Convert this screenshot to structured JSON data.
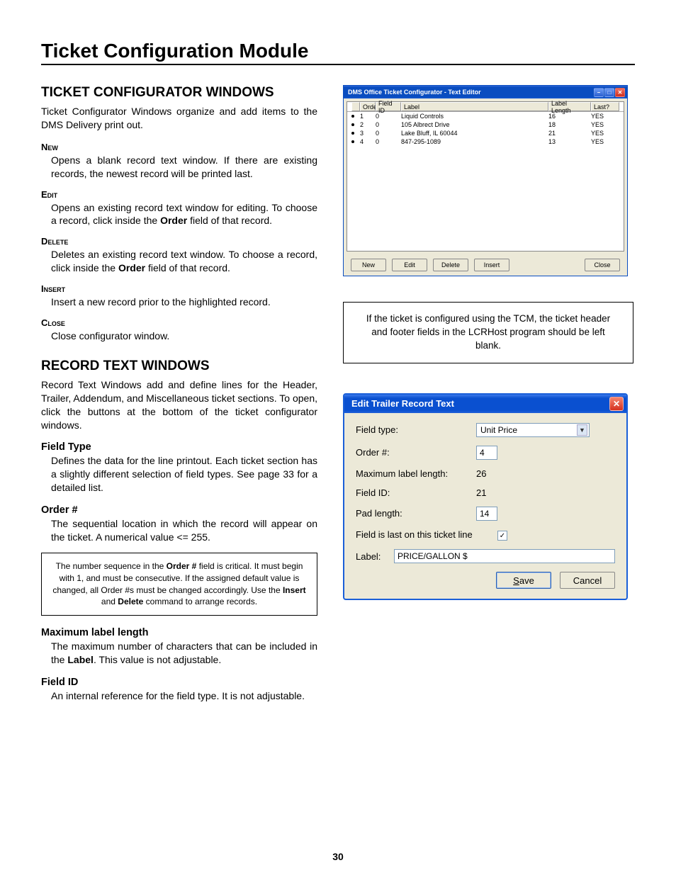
{
  "page": {
    "title": "Ticket Configuration Module",
    "number": "30"
  },
  "section1": {
    "heading": "TICKET CONFIGURATOR WINDOWS",
    "intro": "Ticket Configurator Windows organize and add items to the DMS Delivery print out.",
    "defs": [
      {
        "term": "New",
        "desc_parts": [
          "Opens a blank record text window. If there are existing records, the newest record will be printed last."
        ]
      },
      {
        "term": "Edit",
        "desc_parts": [
          "Opens an existing record text window for editing. To choose a record, click inside the ",
          "Order",
          " field of that record."
        ]
      },
      {
        "term": "Delete",
        "desc_parts": [
          "Deletes an existing record text window. To choose a record, click inside the ",
          "Order",
          " field of that record."
        ]
      },
      {
        "term": "Insert",
        "desc_parts": [
          "Insert a new record prior to the highlighted record."
        ]
      },
      {
        "term": "Close",
        "desc_parts": [
          "Close configurator window."
        ]
      }
    ]
  },
  "section2": {
    "heading": "RECORD TEXT WINDOWS",
    "intro": "Record Text Windows add and define lines for the Header, Trailer, Addendum, and Miscellaneous ticket sections. To open, click the buttons at the bottom of the ticket configurator windows.",
    "defs": [
      {
        "term": "Field Type",
        "desc_parts": [
          "Defines the data for the line printout. Each ticket section has a slightly different selection of field types. See page 33 for a detailed list."
        ]
      },
      {
        "term": "Order #",
        "desc_parts": [
          "The sequential location in which the record will appear on the ticket. A numerical value <= 255."
        ]
      },
      {
        "term": "Maximum label length",
        "desc_parts": [
          "The maximum number of characters that can be included in the ",
          "Label",
          ". This value is not adjustable."
        ]
      },
      {
        "term": "Field ID",
        "desc_parts": [
          "An internal reference for the field type. It is not adjustable."
        ]
      }
    ],
    "note_parts": [
      "The number sequence in the ",
      "Order #",
      " field is critical. It must begin with 1, and must be consecutive. If the assigned default value is changed, all Order #s must be changed accordingly. Use the ",
      "Insert",
      " and ",
      "Delete",
      " command to arrange records."
    ]
  },
  "right_note": "If the ticket is configured using the TCM, the ticket header and footer fields in the LCRHost program should be left blank.",
  "win1": {
    "title": "DMS Office Ticket Configurator - Text Editor",
    "headers": {
      "order": "Order",
      "field_id": "Field ID",
      "label": "Label",
      "label_length": "Label Length",
      "last": "Last?"
    },
    "rows": [
      {
        "order": "1",
        "field_id": "0",
        "label": "Liquid Controls",
        "len": "16",
        "last": "YES"
      },
      {
        "order": "2",
        "field_id": "0",
        "label": "105 Albrect Drive",
        "len": "18",
        "last": "YES"
      },
      {
        "order": "3",
        "field_id": "0",
        "label": "Lake Bluff, IL 60044",
        "len": "21",
        "last": "YES"
      },
      {
        "order": "4",
        "field_id": "0",
        "label": "847-295-1089",
        "len": "13",
        "last": "YES"
      }
    ],
    "buttons": {
      "new": "New",
      "edit": "Edit",
      "delete": "Delete",
      "insert": "Insert",
      "close": "Close"
    }
  },
  "win2": {
    "title": "Edit Trailer Record Text",
    "labels": {
      "field_type": "Field type:",
      "order": "Order #:",
      "max_len": "Maximum label length:",
      "field_id": "Field ID:",
      "pad_len": "Pad length:",
      "is_last": "Field is last on this ticket line",
      "label": "Label:"
    },
    "values": {
      "field_type": "Unit Price",
      "order": "4",
      "max_len": "26",
      "field_id": "21",
      "pad_len": "14",
      "is_last_checked": "✓",
      "label": "PRICE/GALLON $"
    },
    "buttons": {
      "save_u": "S",
      "save_rest": "ave",
      "cancel": "Cancel"
    }
  }
}
